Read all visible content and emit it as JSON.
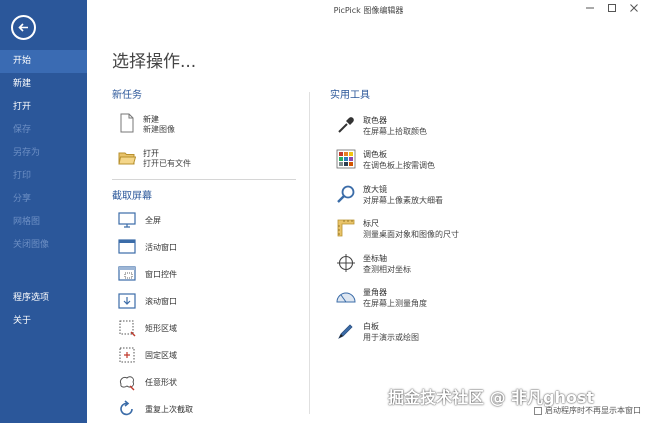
{
  "window": {
    "title": "PicPick 图像编辑器"
  },
  "sidebar": {
    "items": [
      {
        "label": "开始",
        "state": "active"
      },
      {
        "label": "新建",
        "state": "normal"
      },
      {
        "label": "打开",
        "state": "normal"
      },
      {
        "label": "保存",
        "state": "disabled"
      },
      {
        "label": "另存为",
        "state": "disabled"
      },
      {
        "label": "打印",
        "state": "disabled"
      },
      {
        "label": "分享",
        "state": "disabled"
      },
      {
        "label": "网格图",
        "state": "disabled"
      },
      {
        "label": "关闭图像",
        "state": "disabled"
      },
      {
        "label": "程序选项",
        "state": "normal"
      },
      {
        "label": "关于",
        "state": "normal"
      }
    ]
  },
  "main": {
    "title": "选择操作...",
    "new_task": {
      "title": "新任务",
      "items": [
        {
          "label": "新建",
          "desc": "新建图像",
          "icon": "blank-document-icon"
        },
        {
          "label": "打开",
          "desc": "打开已有文件",
          "icon": "open-folder-icon"
        }
      ]
    },
    "capture": {
      "title": "截取屏幕",
      "items": [
        {
          "label": "全屏",
          "icon": "monitor-icon"
        },
        {
          "label": "活动窗口",
          "icon": "active-window-icon"
        },
        {
          "label": "窗口控件",
          "icon": "window-control-icon"
        },
        {
          "label": "滚动窗口",
          "icon": "scrolling-window-icon"
        },
        {
          "label": "矩形区域",
          "icon": "rectangle-region-icon"
        },
        {
          "label": "固定区域",
          "icon": "fixed-region-icon"
        },
        {
          "label": "任意形状",
          "icon": "freehand-shape-icon"
        },
        {
          "label": "重复上次截取",
          "icon": "repeat-capture-icon"
        }
      ]
    },
    "tools": {
      "title": "实用工具",
      "items": [
        {
          "label": "取色器",
          "desc": "在屏幕上拾取颜色",
          "icon": "eyedropper-icon"
        },
        {
          "label": "调色板",
          "desc": "在调色板上按需调色",
          "icon": "palette-grid-icon"
        },
        {
          "label": "放大镜",
          "desc": "对屏幕上像素放大细看",
          "icon": "magnifier-icon"
        },
        {
          "label": "标尺",
          "desc": "测量桌面对象和图像的尺寸",
          "icon": "ruler-icon"
        },
        {
          "label": "坐标轴",
          "desc": "查测相对坐标",
          "icon": "crosshair-icon"
        },
        {
          "label": "量角器",
          "desc": "在屏幕上测量角度",
          "icon": "protractor-icon"
        },
        {
          "label": "白板",
          "desc": "用于演示或绘图",
          "icon": "pen-icon"
        }
      ]
    },
    "startup_option": "启动程序时不再显示本窗口"
  },
  "watermark": "掘金技术社区 @ 非凡ghost",
  "colors": {
    "sidebar": "#2B579A",
    "sidebar_active": "#3A6BB3",
    "accent": "#2B579A"
  }
}
